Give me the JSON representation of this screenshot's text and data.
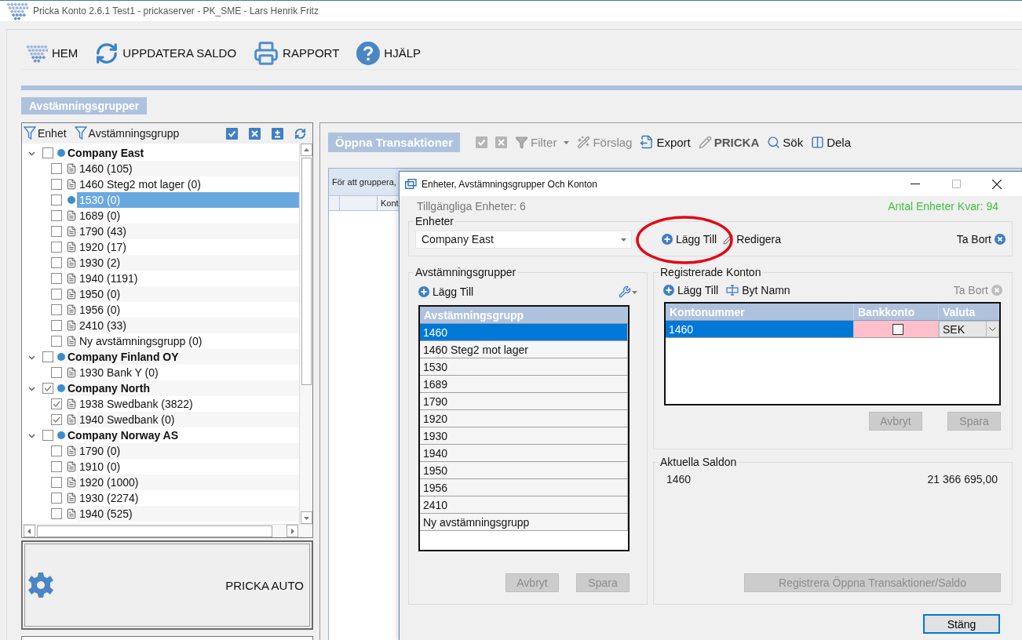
{
  "window": {
    "title": "Pricka Konto 2.6.1 Test1 - prickaserver - PK_SME - Lars Henrik Fritz"
  },
  "toolbar": [
    {
      "label": "HEM",
      "kind": "home"
    },
    {
      "label": "UPPDATERA SALDO",
      "kind": "refresh"
    },
    {
      "label": "RAPPORT",
      "kind": "print"
    },
    {
      "label": "HJÄLP",
      "kind": "help"
    }
  ],
  "section_title": "Avstämningsgrupper",
  "tree_panel": {
    "filters": [
      "Enhet",
      "Avstämningsgrupp"
    ],
    "tree": [
      {
        "label": "Company East",
        "checked": false,
        "expanded": true,
        "children": [
          {
            "label": "1460 (105)",
            "checked": false,
            "selected": false,
            "kind": "document"
          },
          {
            "label": "1460 Steg2 mot lager (0)",
            "checked": false,
            "selected": false,
            "kind": "document"
          },
          {
            "label": "1530 (0)",
            "checked": false,
            "selected": true,
            "kind": "dot"
          },
          {
            "label": "1689 (0)",
            "checked": false,
            "selected": false,
            "kind": "document"
          },
          {
            "label": "1790 (43)",
            "checked": false,
            "selected": false,
            "kind": "document"
          },
          {
            "label": "1920 (17)",
            "checked": false,
            "selected": false,
            "kind": "document"
          },
          {
            "label": "1930 (2)",
            "checked": false,
            "selected": false,
            "kind": "document"
          },
          {
            "label": "1940 (1191)",
            "checked": false,
            "selected": false,
            "kind": "document"
          },
          {
            "label": "1950 (0)",
            "checked": false,
            "selected": false,
            "kind": "document"
          },
          {
            "label": "1956 (0)",
            "checked": false,
            "selected": false,
            "kind": "document"
          },
          {
            "label": "2410 (33)",
            "checked": false,
            "selected": false,
            "kind": "document"
          },
          {
            "label": "Ny avstämningsgrupp (0)",
            "checked": false,
            "selected": false,
            "kind": "document"
          }
        ]
      },
      {
        "label": "Company Finland OY",
        "checked": false,
        "expanded": true,
        "children": [
          {
            "label": "1930 Bank Y (0)",
            "checked": false,
            "selected": false,
            "kind": "document"
          }
        ]
      },
      {
        "label": "Company North",
        "checked": true,
        "expanded": true,
        "children": [
          {
            "label": "1938 Swedbank (3822)",
            "checked": true,
            "selected": false,
            "kind": "document"
          },
          {
            "label": "1940 Swedbank (0)",
            "checked": true,
            "selected": false,
            "kind": "document"
          }
        ]
      },
      {
        "label": "Company Norway AS",
        "checked": false,
        "expanded": true,
        "children": [
          {
            "label": "1790 (0)",
            "checked": false,
            "selected": false,
            "kind": "document"
          },
          {
            "label": "1910 (0)",
            "checked": false,
            "selected": false,
            "kind": "document"
          },
          {
            "label": "1920 (1000)",
            "checked": false,
            "selected": false,
            "kind": "document"
          },
          {
            "label": "1930 (2274)",
            "checked": false,
            "selected": false,
            "kind": "document"
          },
          {
            "label": "1940 (525)",
            "checked": false,
            "selected": false,
            "kind": "document"
          }
        ]
      }
    ],
    "auto_button": "PRICKA AUTO"
  },
  "transactions": {
    "title": "Öppna Transaktioner",
    "actions": [
      {
        "label": "Filter",
        "kind": "filter",
        "disabled": true,
        "bold": false
      },
      {
        "label": "Förslag",
        "kind": "wand",
        "disabled": true,
        "bold": false
      },
      {
        "label": "Export",
        "kind": "export",
        "disabled": false,
        "bold": false
      },
      {
        "label": "PRICKA",
        "kind": "pencil",
        "disabled": false,
        "bold": true
      },
      {
        "label": "Sök",
        "kind": "search",
        "disabled": false,
        "bold": false
      },
      {
        "label": "Dela",
        "kind": "split",
        "disabled": false,
        "bold": false
      }
    ],
    "group_hint": "För att gruppera,",
    "column_1": "Kont"
  },
  "dialog": {
    "title": "Enheter, Avstämningsgrupper Och Konton",
    "available": "Tillgängliga Enheter: 6",
    "remaining": "Antal Enheter Kvar: 94",
    "units": {
      "legend": "Enheter",
      "value": "Company East",
      "add": {
        "label": "Lägg Till",
        "highlighted": true
      },
      "edit": "Redigera",
      "remove": {
        "label": "Ta Bort",
        "disabled": false
      }
    },
    "groups": {
      "legend": "Avstämningsgrupper",
      "add": "Lägg Till",
      "column": "Avstämningsgrupp",
      "rows": [
        {
          "label": "1460",
          "selected": true
        },
        {
          "label": "1460 Steg2 mot lager",
          "selected": false
        },
        {
          "label": "1530",
          "selected": false
        },
        {
          "label": "1689",
          "selected": false
        },
        {
          "label": "1790",
          "selected": false
        },
        {
          "label": "1920",
          "selected": false
        },
        {
          "label": "1930",
          "selected": false
        },
        {
          "label": "1940",
          "selected": false
        },
        {
          "label": "1950",
          "selected": false
        },
        {
          "label": "1956",
          "selected": false
        },
        {
          "label": "2410",
          "selected": false
        },
        {
          "label": "Ny avstämningsgrupp",
          "selected": false
        }
      ],
      "cancel": {
        "label": "Avbryt",
        "disabled": true
      },
      "save": {
        "label": "Spara",
        "disabled": true
      }
    },
    "accounts": {
      "legend": "Registrerade Konton",
      "add": "Lägg Till",
      "rename": "Byt Namn",
      "remove": {
        "label": "Ta Bort",
        "disabled": true
      },
      "columns": [
        "Kontonummer",
        "Bankkonto",
        "Valuta"
      ],
      "rows": [
        {
          "number": "1460",
          "bank_account": false,
          "currency": "SEK",
          "selected": true
        }
      ],
      "cancel": {
        "label": "Avbryt",
        "disabled": true
      },
      "save": {
        "label": "Spara",
        "disabled": true
      }
    },
    "balances": {
      "legend": "Aktuella Saldon",
      "rows": [
        {
          "account": "1460",
          "amount": "21 366 695,00"
        }
      ],
      "register": {
        "label": "Registrera Öppna Transaktioner/Saldo",
        "disabled": true
      }
    },
    "close": "Stäng"
  }
}
